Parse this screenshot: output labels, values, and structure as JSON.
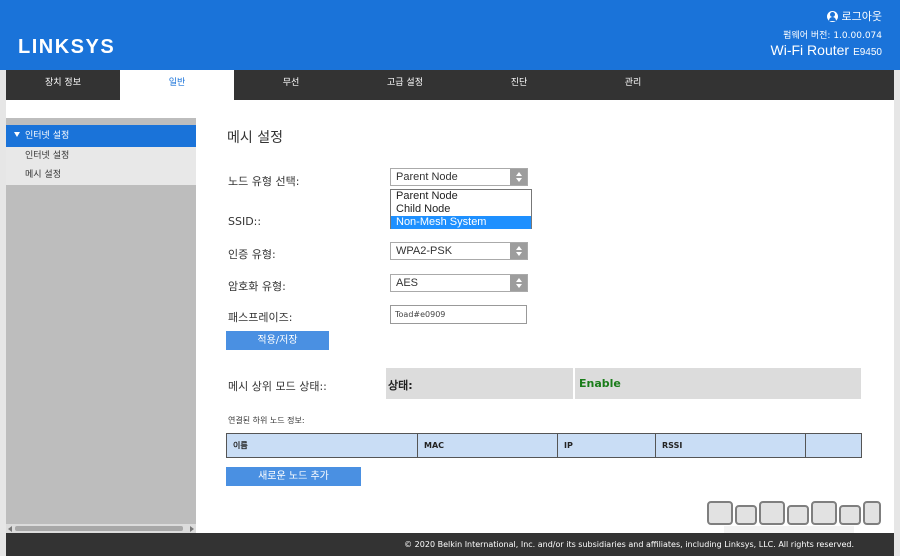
{
  "header": {
    "logo": "LINKSYS",
    "logout": "로그아웃",
    "firmware": "펌웨어 버전: 1.0.00.074",
    "model": "Wi-Fi Router",
    "model_number": "E9450"
  },
  "nav": [
    "장치 정보",
    "일반",
    "무선",
    "고급 설정",
    "진단",
    "관리"
  ],
  "nav_active": "일반",
  "sidebar": {
    "section": "인터넷 설정",
    "items": [
      "인터넷 설정",
      "메시 설정"
    ]
  },
  "main": {
    "title": "메시 설정",
    "node_type_label": "노드 유형 선택:",
    "node_type_value": "Parent Node",
    "node_type_options": [
      "Parent Node",
      "Child Node",
      "Non-Mesh System"
    ],
    "node_type_highlighted": "Non-Mesh System",
    "ssid_label": "SSID::",
    "auth_label": "인증 유형:",
    "auth_value": "WPA2-PSK",
    "encrypt_label": "암호화 유형:",
    "encrypt_value": "AES",
    "passphrase_label": "패스프레이즈:",
    "passphrase_value": "Toad#e0909",
    "apply_button": "적용/저장",
    "mesh_status_label": "메시 상위 모드 상태::",
    "status_key": "상태:",
    "status_value": "Enable",
    "child_info_label": "연결된 하위 노드 정보:",
    "table_headers": [
      "이름",
      "MAC",
      "IP",
      "RSSI",
      ""
    ],
    "add_node_button": "새로운 노드 추가"
  },
  "footer": "© 2020 Belkin International, Inc. and/or its subsidiaries and affiliates, including Linksys, LLC. All rights reserved.",
  "colors": {
    "brand_blue": "#1a73d9",
    "nav_dark": "#333333",
    "button_blue": "#4a90e2",
    "status_green": "#1a7d1a",
    "table_header": "#c9ddf5",
    "sidebar_gray": "#bdbdbd"
  }
}
